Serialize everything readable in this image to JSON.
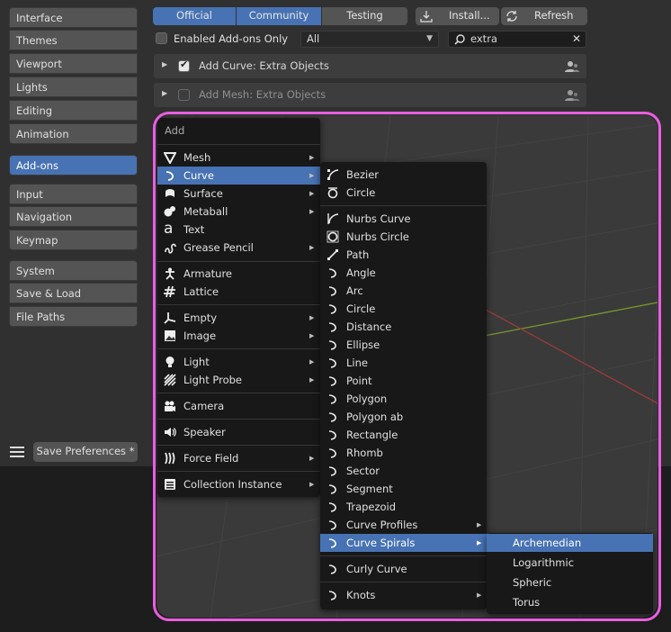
{
  "sidebar": {
    "items": [
      {
        "label": "Interface"
      },
      {
        "label": "Themes"
      },
      {
        "label": "Viewport"
      },
      {
        "label": "Lights"
      },
      {
        "label": "Editing"
      },
      {
        "label": "Animation"
      },
      {
        "label": "Add-ons"
      },
      {
        "label": "Input"
      },
      {
        "label": "Navigation"
      },
      {
        "label": "Keymap"
      },
      {
        "label": "System"
      },
      {
        "label": "Save & Load"
      },
      {
        "label": "File Paths"
      }
    ],
    "active": "Add-ons",
    "save_label": "Save Preferences *"
  },
  "toolbar": {
    "tabs": [
      {
        "label": "Official"
      },
      {
        "label": "Community"
      },
      {
        "label": "Testing"
      }
    ],
    "install_label": "Install...",
    "refresh_label": "Refresh",
    "enabled_only_label": "Enabled Add-ons Only",
    "category_value": "All",
    "search_value": "extra"
  },
  "addons": [
    {
      "label": "Add Curve: Extra Objects",
      "enabled": true
    },
    {
      "label": "Add Mesh: Extra Objects",
      "enabled": false
    }
  ],
  "add_menu": {
    "title": "Add",
    "items": [
      {
        "label": "Mesh",
        "icon": "mesh-icon"
      },
      {
        "label": "Curve",
        "icon": "curve-icon"
      },
      {
        "label": "Surface",
        "icon": "surface-icon"
      },
      {
        "label": "Metaball",
        "icon": "metaball-icon"
      },
      {
        "label": "Text",
        "icon": "text-icon"
      },
      {
        "label": "Grease Pencil",
        "icon": "grease-pencil-icon"
      },
      {
        "label": "Armature",
        "icon": "armature-icon"
      },
      {
        "label": "Lattice",
        "icon": "lattice-icon"
      },
      {
        "label": "Empty",
        "icon": "empty-icon"
      },
      {
        "label": "Image",
        "icon": "image-icon"
      },
      {
        "label": "Light",
        "icon": "light-icon"
      },
      {
        "label": "Light Probe",
        "icon": "light-probe-icon"
      },
      {
        "label": "Camera",
        "icon": "camera-icon"
      },
      {
        "label": "Speaker",
        "icon": "speaker-icon"
      },
      {
        "label": "Force Field",
        "icon": "force-field-icon"
      },
      {
        "label": "Collection Instance",
        "icon": "collection-instance-icon"
      }
    ]
  },
  "curve_menu": {
    "items": [
      {
        "label": "Bezier",
        "icon": "bezier-curve-icon"
      },
      {
        "label": "Circle",
        "icon": "bezier-circle-icon"
      },
      {
        "label": "Nurbs Curve",
        "icon": "nurbs-curve-icon"
      },
      {
        "label": "Nurbs Circle",
        "icon": "nurbs-circle-icon"
      },
      {
        "label": "Path",
        "icon": "path-icon"
      },
      {
        "label": "Angle",
        "icon": "curve-icon"
      },
      {
        "label": "Arc",
        "icon": "curve-icon"
      },
      {
        "label": "Circle",
        "icon": "curve-icon"
      },
      {
        "label": "Distance",
        "icon": "curve-icon"
      },
      {
        "label": "Ellipse",
        "icon": "curve-icon"
      },
      {
        "label": "Line",
        "icon": "curve-icon"
      },
      {
        "label": "Point",
        "icon": "curve-icon"
      },
      {
        "label": "Polygon",
        "icon": "curve-icon"
      },
      {
        "label": "Polygon ab",
        "icon": "curve-icon"
      },
      {
        "label": "Rectangle",
        "icon": "curve-icon"
      },
      {
        "label": "Rhomb",
        "icon": "curve-icon"
      },
      {
        "label": "Sector",
        "icon": "curve-icon"
      },
      {
        "label": "Segment",
        "icon": "curve-icon"
      },
      {
        "label": "Trapezoid",
        "icon": "curve-icon"
      },
      {
        "label": "Curve Profiles",
        "icon": "curve-icon"
      },
      {
        "label": "Curve Spirals",
        "icon": "curve-icon"
      },
      {
        "label": "Curly Curve",
        "icon": "curve-icon"
      },
      {
        "label": "Knots",
        "icon": "curve-icon"
      }
    ]
  },
  "spiral_menu": {
    "items": [
      {
        "label": "Archemedian"
      },
      {
        "label": "Logarithmic"
      },
      {
        "label": "Spheric"
      },
      {
        "label": "Torus"
      }
    ]
  },
  "colors": {
    "accent": "#4772b3",
    "highlight": "#ea5ee0"
  }
}
